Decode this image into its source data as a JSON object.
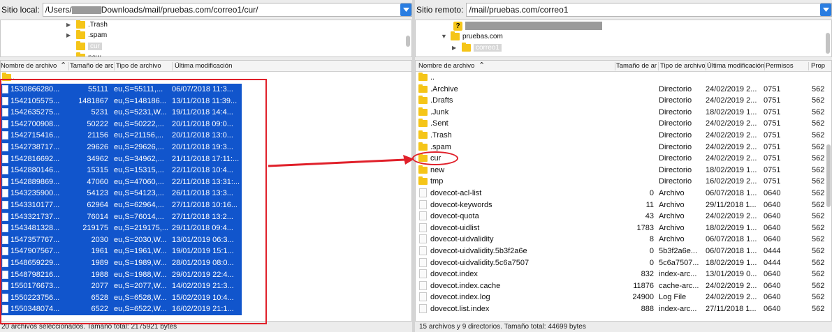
{
  "local": {
    "site_label": "Sitio local:",
    "path_prefix": "/Users/",
    "path_suffix": "Downloads/mail/pruebas.com/correo1/cur/",
    "tree": [
      ".Trash",
      ".spam",
      "cur",
      "new"
    ],
    "headers": [
      "Nombre de archivo",
      "Tamaño de arc",
      "Tipo de archivo",
      "Última modificación"
    ],
    "parent": "..",
    "files": [
      {
        "name": "1530866280...",
        "size": "55111",
        "type": "eu,S=55111,...",
        "mod": "06/07/2018 11:3..."
      },
      {
        "name": "1542105575...",
        "size": "1481867",
        "type": "eu,S=148186...",
        "mod": "13/11/2018 11:39..."
      },
      {
        "name": "1542635275...",
        "size": "5231",
        "type": "eu,S=5231,W...",
        "mod": "19/11/2018 14:4..."
      },
      {
        "name": "1542700908...",
        "size": "50222",
        "type": "eu,S=50222,...",
        "mod": "20/11/2018 09:0..."
      },
      {
        "name": "1542715416...",
        "size": "21156",
        "type": "eu,S=21156,...",
        "mod": "20/11/2018 13:0..."
      },
      {
        "name": "1542738717...",
        "size": "29626",
        "type": "eu,S=29626,...",
        "mod": "20/11/2018 19:3..."
      },
      {
        "name": "1542816692...",
        "size": "34962",
        "type": "eu,S=34962,...",
        "mod": "21/11/2018 17:11:..."
      },
      {
        "name": "1542880146...",
        "size": "15315",
        "type": "eu,S=15315,...",
        "mod": "22/11/2018 10:4..."
      },
      {
        "name": "1542889869...",
        "size": "47060",
        "type": "eu,S=47060,...",
        "mod": "22/11/2018 13:31:..."
      },
      {
        "name": "1543235900...",
        "size": "54123",
        "type": "eu,S=54123,...",
        "mod": "26/11/2018 13:3..."
      },
      {
        "name": "1543310177...",
        "size": "62964",
        "type": "eu,S=62964,...",
        "mod": "27/11/2018 10:16..."
      },
      {
        "name": "1543321737...",
        "size": "76014",
        "type": "eu,S=76014,...",
        "mod": "27/11/2018 13:2..."
      },
      {
        "name": "1543481328...",
        "size": "219175",
        "type": "eu,S=219175,...",
        "mod": "29/11/2018 09:4..."
      },
      {
        "name": "1547357767...",
        "size": "2030",
        "type": "eu,S=2030,W...",
        "mod": "13/01/2019 06:3..."
      },
      {
        "name": "1547907567...",
        "size": "1961",
        "type": "eu,S=1961,W...",
        "mod": "19/01/2019 15:1..."
      },
      {
        "name": "1548659229...",
        "size": "1989",
        "type": "eu,S=1989,W...",
        "mod": "28/01/2019 08:0..."
      },
      {
        "name": "1548798216...",
        "size": "1988",
        "type": "eu,S=1988,W...",
        "mod": "29/01/2019 22:4..."
      },
      {
        "name": "1550176673...",
        "size": "2077",
        "type": "eu,S=2077,W...",
        "mod": "14/02/2019 21:3..."
      },
      {
        "name": "1550223756...",
        "size": "6528",
        "type": "eu,S=6528,W...",
        "mod": "15/02/2019 10:4..."
      },
      {
        "name": "1550348074...",
        "size": "6522",
        "type": "eu,S=6522,W...",
        "mod": "16/02/2019 21:1..."
      }
    ],
    "status": "20 archivos seleccionados. Tamaño total: 2175921 bytes"
  },
  "remote": {
    "site_label": "Sitio remoto:",
    "path": "/mail/pruebas.com/correo1",
    "tree": [
      "pruebas.com",
      "correo1"
    ],
    "headers": [
      "Nombre de archivo",
      "Tamaño de ar",
      "Tipo de archivo",
      "Última modificación",
      "Permisos",
      "Prop"
    ],
    "items": [
      {
        "name": "..",
        "size": "",
        "type": "",
        "mod": "",
        "perm": "",
        "owner": "",
        "kind": "folder"
      },
      {
        "name": ".Archive",
        "size": "",
        "type": "Directorio",
        "mod": "24/02/2019 2...",
        "perm": "0751",
        "owner": "562",
        "kind": "folder"
      },
      {
        "name": ".Drafts",
        "size": "",
        "type": "Directorio",
        "mod": "24/02/2019 2...",
        "perm": "0751",
        "owner": "562",
        "kind": "folder"
      },
      {
        "name": ".Junk",
        "size": "",
        "type": "Directorio",
        "mod": "18/02/2019 1...",
        "perm": "0751",
        "owner": "562",
        "kind": "folder"
      },
      {
        "name": ".Sent",
        "size": "",
        "type": "Directorio",
        "mod": "24/02/2019 2...",
        "perm": "0751",
        "owner": "562",
        "kind": "folder"
      },
      {
        "name": ".Trash",
        "size": "",
        "type": "Directorio",
        "mod": "24/02/2019 2...",
        "perm": "0751",
        "owner": "562",
        "kind": "folder"
      },
      {
        "name": ".spam",
        "size": "",
        "type": "Directorio",
        "mod": "24/02/2019 2...",
        "perm": "0751",
        "owner": "562",
        "kind": "folder"
      },
      {
        "name": "cur",
        "size": "",
        "type": "Directorio",
        "mod": "24/02/2019 2...",
        "perm": "0751",
        "owner": "562",
        "kind": "folder"
      },
      {
        "name": "new",
        "size": "",
        "type": "Directorio",
        "mod": "18/02/2019 1...",
        "perm": "0751",
        "owner": "562",
        "kind": "folder"
      },
      {
        "name": "tmp",
        "size": "",
        "type": "Directorio",
        "mod": "16/02/2019 2...",
        "perm": "0751",
        "owner": "562",
        "kind": "folder"
      },
      {
        "name": "dovecot-acl-list",
        "size": "0",
        "type": "Archivo",
        "mod": "06/07/2018 1...",
        "perm": "0640",
        "owner": "562",
        "kind": "file"
      },
      {
        "name": "dovecot-keywords",
        "size": "11",
        "type": "Archivo",
        "mod": "29/11/2018 1...",
        "perm": "0640",
        "owner": "562",
        "kind": "file"
      },
      {
        "name": "dovecot-quota",
        "size": "43",
        "type": "Archivo",
        "mod": "24/02/2019 2...",
        "perm": "0640",
        "owner": "562",
        "kind": "file"
      },
      {
        "name": "dovecot-uidlist",
        "size": "1783",
        "type": "Archivo",
        "mod": "18/02/2019 1...",
        "perm": "0640",
        "owner": "562",
        "kind": "file"
      },
      {
        "name": "dovecot-uidvalidity",
        "size": "8",
        "type": "Archivo",
        "mod": "06/07/2018 1...",
        "perm": "0640",
        "owner": "562",
        "kind": "file"
      },
      {
        "name": "dovecot-uidvalidity.5b3f2a6e",
        "size": "0",
        "type": "5b3f2a6e...",
        "mod": "06/07/2018 1...",
        "perm": "0444",
        "owner": "562",
        "kind": "file"
      },
      {
        "name": "dovecot-uidvalidity.5c6a7507",
        "size": "0",
        "type": "5c6a7507...",
        "mod": "18/02/2019 1...",
        "perm": "0444",
        "owner": "562",
        "kind": "file"
      },
      {
        "name": "dovecot.index",
        "size": "832",
        "type": "index-arc...",
        "mod": "13/01/2019 0...",
        "perm": "0640",
        "owner": "562",
        "kind": "file"
      },
      {
        "name": "dovecot.index.cache",
        "size": "11876",
        "type": "cache-arc...",
        "mod": "24/02/2019 2...",
        "perm": "0640",
        "owner": "562",
        "kind": "file"
      },
      {
        "name": "dovecot.index.log",
        "size": "24900",
        "type": "Log File",
        "mod": "24/02/2019 2...",
        "perm": "0640",
        "owner": "562",
        "kind": "file"
      },
      {
        "name": "dovecot.list.index",
        "size": "888",
        "type": "index-arc...",
        "mod": "27/11/2018 1...",
        "perm": "0640",
        "owner": "562",
        "kind": "file"
      }
    ],
    "status": "15 archivos y 9 directorios. Tamaño total: 44699 bytes"
  },
  "colors": {
    "selection": "#1155cc",
    "annotation": "#e0202a",
    "folder": "#f5c518"
  }
}
